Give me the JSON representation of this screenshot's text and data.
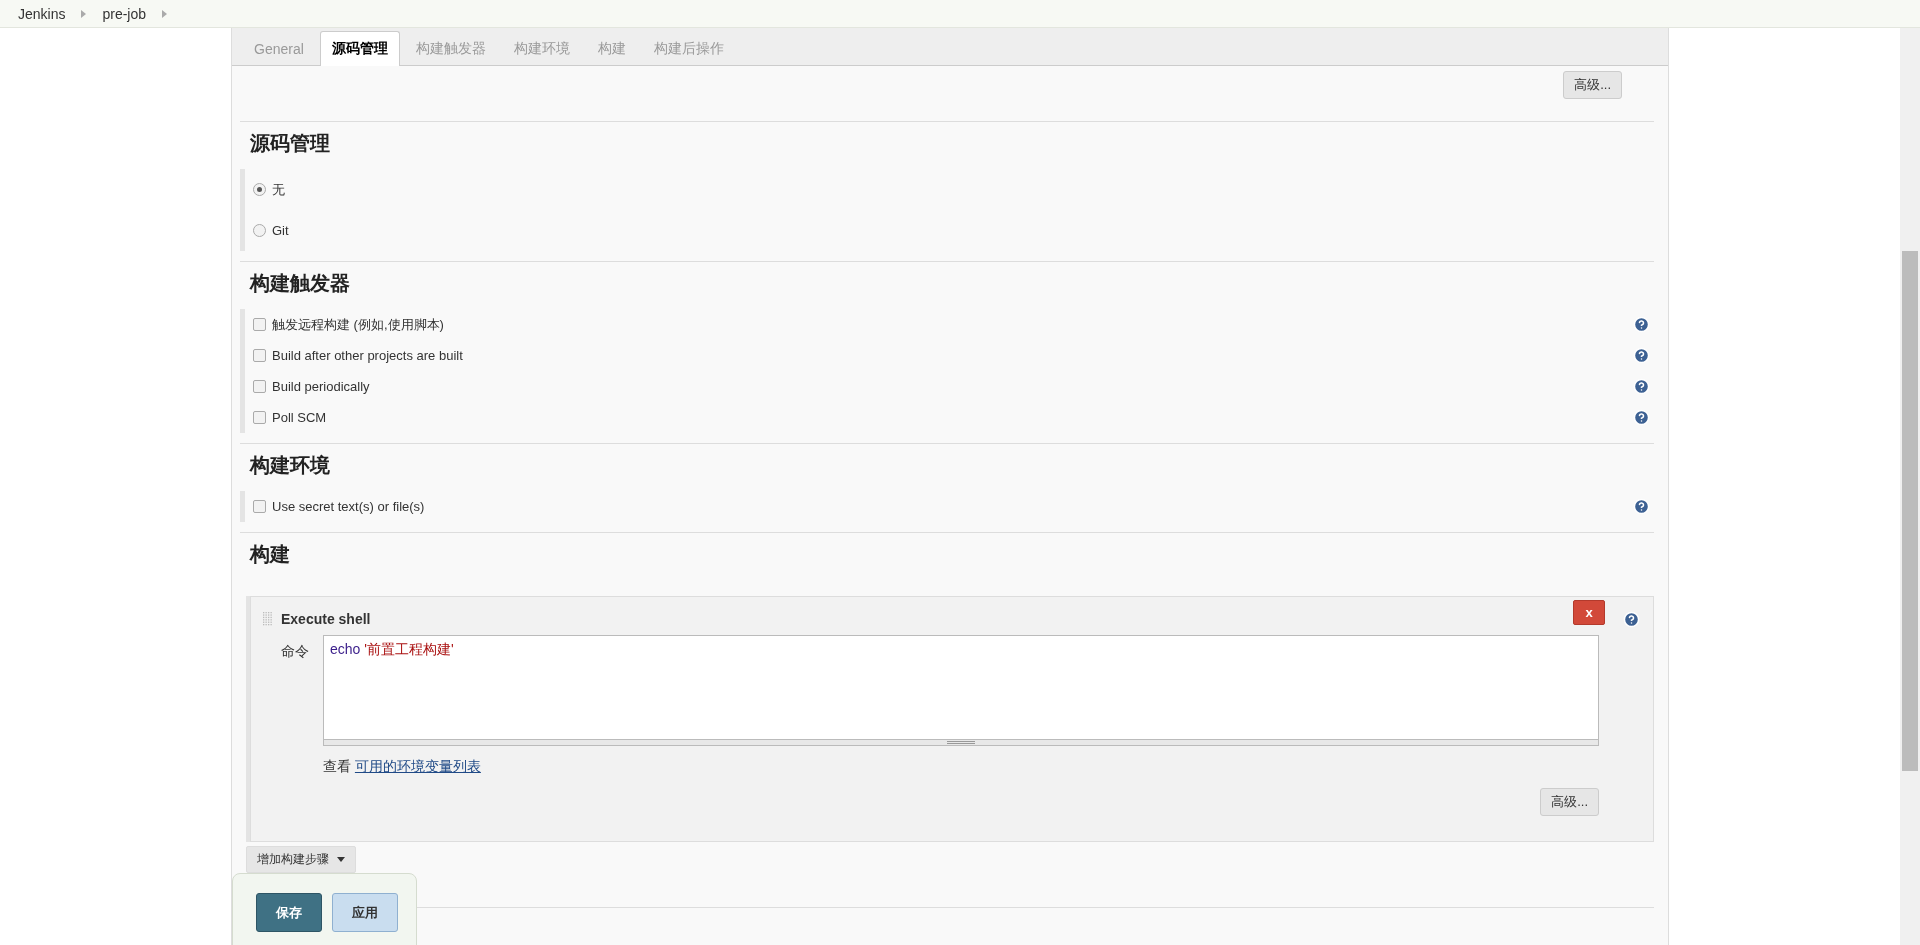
{
  "breadcrumbs": [
    "Jenkins",
    "pre-job"
  ],
  "tabs": [
    {
      "label": "General",
      "selected": false
    },
    {
      "label": "源码管理",
      "selected": true
    },
    {
      "label": "构建触发器",
      "selected": false
    },
    {
      "label": "构建环境",
      "selected": false
    },
    {
      "label": "构建",
      "selected": false
    },
    {
      "label": "构建后操作",
      "selected": false
    }
  ],
  "top_advanced_button": "高级...",
  "sections": [
    {
      "title": "源码管理",
      "kind": "radio",
      "options": [
        {
          "label": "无",
          "selected": true
        },
        {
          "label": "Git",
          "selected": false
        }
      ]
    },
    {
      "title": "构建触发器",
      "kind": "checkbox",
      "options": [
        {
          "label": "触发远程构建 (例如,使用脚本)",
          "checked": false
        },
        {
          "label": "Build after other projects are built",
          "checked": false
        },
        {
          "label": "Build periodically",
          "checked": false
        },
        {
          "label": "Poll SCM",
          "checked": false
        }
      ]
    },
    {
      "title": "构建环境",
      "kind": "checkbox",
      "options": [
        {
          "label": "Use secret text(s) or file(s)",
          "checked": false
        }
      ]
    }
  ],
  "build": {
    "title": "构建",
    "step": {
      "title": "Execute shell",
      "delete_label": "x",
      "command_label": "命令",
      "command_keyword": "echo",
      "command_string": "'前置工程构建'",
      "env_prefix": "查看",
      "env_link": "可用的环境变量列表",
      "advanced_button": "高级..."
    },
    "add_step_button": "增加构建步骤"
  },
  "save_bar": {
    "save_button": "保存",
    "apply_button": "应用"
  }
}
